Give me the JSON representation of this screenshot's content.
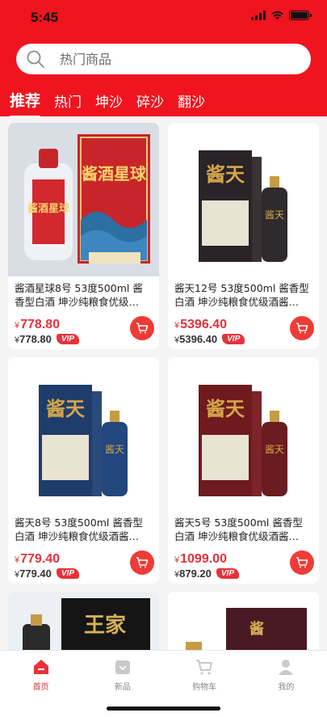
{
  "status_bar": {
    "time": "5:45"
  },
  "search": {
    "placeholder": "热门商品"
  },
  "tabs": [
    {
      "label": "推荐",
      "active": true
    },
    {
      "label": "热门",
      "active": false
    },
    {
      "label": "坤沙",
      "active": false
    },
    {
      "label": "碎沙",
      "active": false
    },
    {
      "label": "翻沙",
      "active": false
    }
  ],
  "products": [
    {
      "title": "酱酒星球8号 53度500ml 酱香型白酒 坤沙纯粮食优级…",
      "currency": "¥",
      "price": "778.80",
      "vip_price": "778.80",
      "vip_label": "VIP",
      "image_text": "酱酒星球"
    },
    {
      "title": "酱天12号 53度500ml 酱香型白酒 坤沙纯粮食优级酒酱…",
      "currency": "¥",
      "price": "5396.40",
      "vip_price": "5396.40",
      "vip_label": "VIP",
      "image_text": "酱天"
    },
    {
      "title": "酱天8号 53度500ml 酱香型白酒 坤沙纯粮食优级酒酱…",
      "currency": "¥",
      "price": "779.40",
      "vip_price": "779.40",
      "vip_label": "VIP",
      "image_text": "酱天"
    },
    {
      "title": "酱天5号 53度500ml 酱香型白酒 坤沙纯粮食优级酒酱…",
      "currency": "¥",
      "price": "1099.00",
      "vip_price": "879.20",
      "vip_label": "VIP",
      "image_text": "酱天"
    },
    {
      "title": "",
      "image_text": "王家"
    },
    {
      "title": "",
      "image_text": "酱"
    }
  ],
  "tabbar": [
    {
      "label": "首页",
      "icon": "home-icon",
      "active": true
    },
    {
      "label": "新品",
      "icon": "new-icon",
      "active": false
    },
    {
      "label": "购物车",
      "icon": "cart-icon",
      "active": false
    },
    {
      "label": "我的",
      "icon": "user-icon",
      "active": false
    }
  ],
  "colors": {
    "brand": "#f0141e",
    "price": "#e8313a",
    "tab_inactive": "#888888"
  }
}
